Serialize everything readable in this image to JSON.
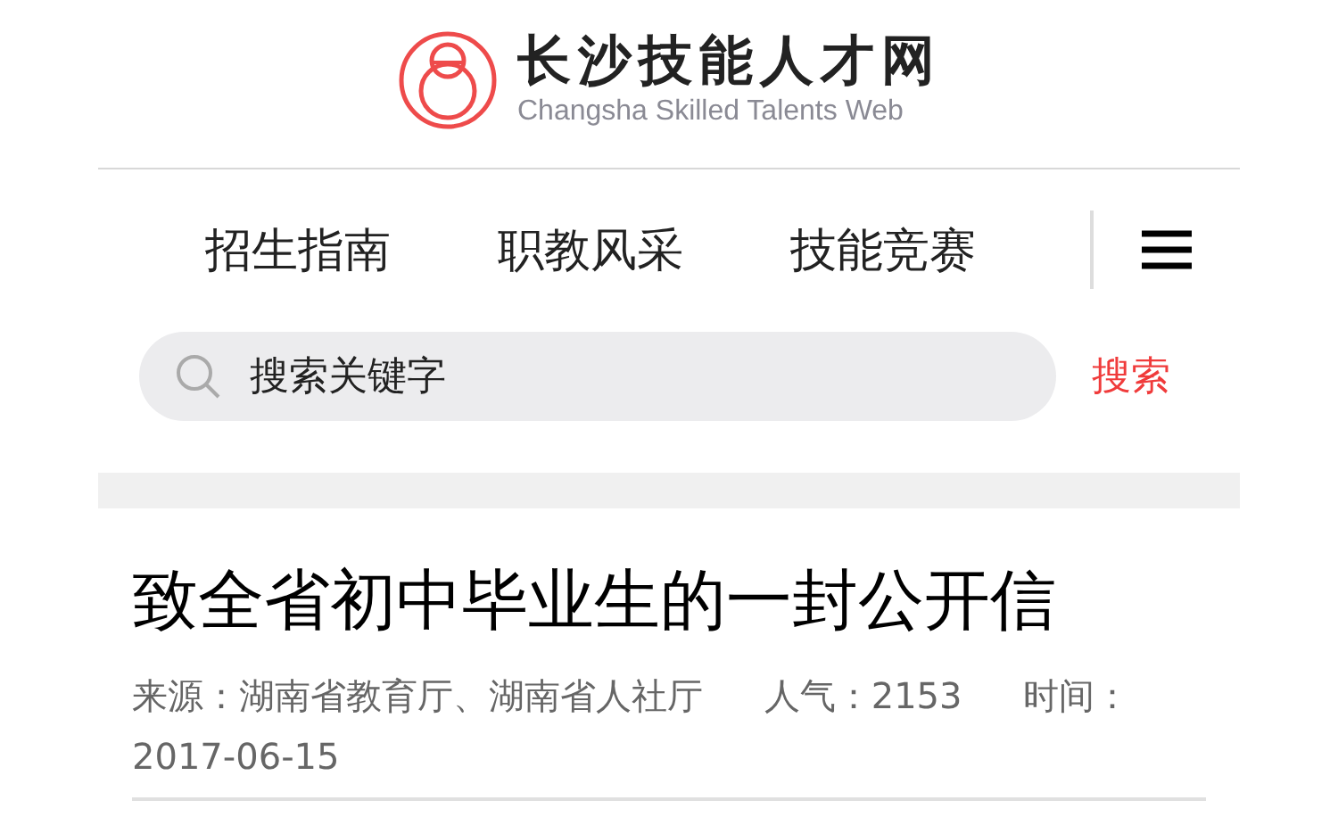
{
  "logo": {
    "title": "长沙技能人才网",
    "subtitle": "Changsha Skilled Talents Web"
  },
  "nav": {
    "items": [
      {
        "label": "招生指南"
      },
      {
        "label": "职教风采"
      },
      {
        "label": "技能竞赛"
      }
    ]
  },
  "search": {
    "placeholder": "搜索关键字",
    "button": "搜索"
  },
  "article": {
    "title": "致全省初中毕业生的一封公开信",
    "meta": [
      "来源：湖南省教育厅、湖南省人社厅",
      "人气：2153",
      "时间：2017-06-15"
    ]
  }
}
